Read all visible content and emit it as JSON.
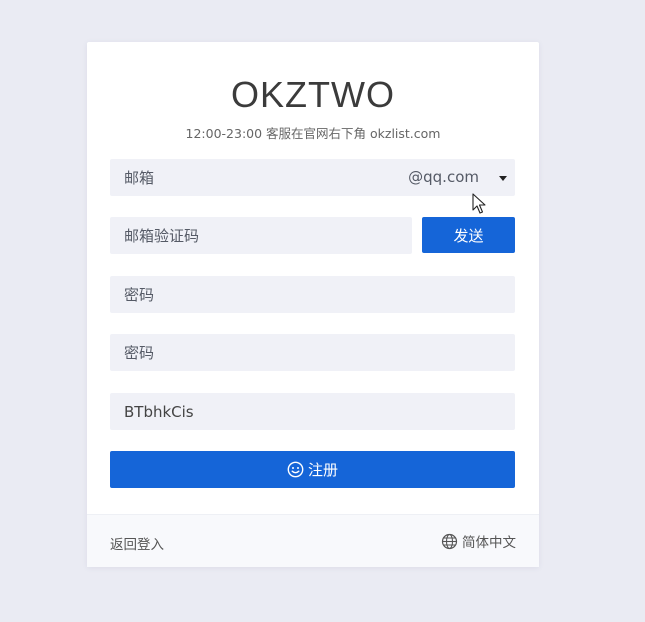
{
  "header": {
    "title": "OKZTWO",
    "subtitle": "12:00-23:00 客服在官网右下角 okzlist.com"
  },
  "form": {
    "email": {
      "placeholder": "邮箱",
      "suffix": "@qq.com"
    },
    "code": {
      "placeholder": "邮箱验证码"
    },
    "send_label": "发送",
    "password": {
      "placeholder": "密码"
    },
    "password_confirm": {
      "placeholder": "密码"
    },
    "invite": {
      "value": "BTbhkCis"
    },
    "register_label": "注册"
  },
  "footer": {
    "back_label": "返回登入",
    "lang_label": "简体中文"
  },
  "colors": {
    "accent": "#1565d8",
    "background": "#eaebf3",
    "field": "#f0f1f7"
  }
}
